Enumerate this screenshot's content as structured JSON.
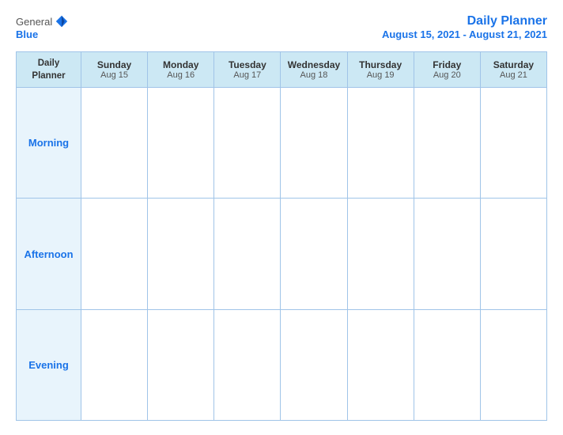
{
  "header": {
    "logo_general": "General",
    "logo_blue": "Blue",
    "title": "Daily Planner",
    "date_range": "August 15, 2021 - August 21, 2021"
  },
  "table": {
    "label_header_line1": "Daily",
    "label_header_line2": "Planner",
    "columns": [
      {
        "day": "Sunday",
        "date": "Aug 15"
      },
      {
        "day": "Monday",
        "date": "Aug 16"
      },
      {
        "day": "Tuesday",
        "date": "Aug 17"
      },
      {
        "day": "Wednesday",
        "date": "Aug 18"
      },
      {
        "day": "Thursday",
        "date": "Aug 19"
      },
      {
        "day": "Friday",
        "date": "Aug 20"
      },
      {
        "day": "Saturday",
        "date": "Aug 21"
      }
    ],
    "rows": [
      {
        "label": "Morning"
      },
      {
        "label": "Afternoon"
      },
      {
        "label": "Evening"
      }
    ]
  }
}
